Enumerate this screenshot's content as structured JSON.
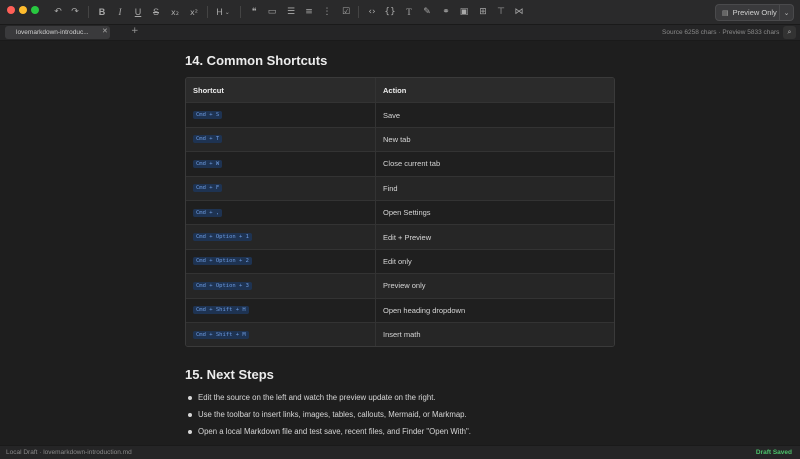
{
  "toolbar": {
    "icons": [
      "undo-icon",
      "redo-icon",
      "bold-icon",
      "italic-icon",
      "underline-icon",
      "strikethrough-icon",
      "subscript-icon",
      "superscript-icon",
      "heading-icon",
      "blockquote-icon",
      "comment-icon",
      "bullet-list-icon",
      "ordered-list-icon",
      "numbered-list-icon",
      "task-list-icon",
      "code-icon",
      "code-block-icon",
      "text-format-icon",
      "highlight-icon",
      "link-icon",
      "image-icon",
      "table-icon",
      "mermaid-icon",
      "markmap-icon"
    ],
    "heading_label": "H",
    "view_mode": "Preview Only"
  },
  "tabs": {
    "active_tab": "lovemarkdown-introduc...",
    "stats": "Source 6258 chars · Preview 5833 chars"
  },
  "doc": {
    "section14_title": "14. Common Shortcuts",
    "table": {
      "headers": [
        "Shortcut",
        "Action"
      ],
      "rows": [
        {
          "shortcut": "Cmd + S",
          "action": "Save"
        },
        {
          "shortcut": "Cmd + T",
          "action": "New tab"
        },
        {
          "shortcut": "Cmd + W",
          "action": "Close current tab"
        },
        {
          "shortcut": "Cmd + F",
          "action": "Find"
        },
        {
          "shortcut": "Cmd + ,",
          "action": "Open Settings"
        },
        {
          "shortcut": "Cmd + Option + 1",
          "action": "Edit + Preview"
        },
        {
          "shortcut": "Cmd + Option + 2",
          "action": "Edit only"
        },
        {
          "shortcut": "Cmd + Option + 3",
          "action": "Preview only"
        },
        {
          "shortcut": "Cmd + Shift + H",
          "action": "Open heading dropdown"
        },
        {
          "shortcut": "Cmd + Shift + M",
          "action": "Insert math"
        }
      ]
    },
    "section15_title": "15. Next Steps",
    "steps": [
      "Edit the source on the left and watch the preview update on the right.",
      "Use the toolbar to insert links, images, tables, callouts, Mermaid, or Markmap.",
      "Open a local Markdown file and test save, recent files, and Finder \"Open With\"."
    ]
  },
  "status": {
    "left": "Local Draft · lovemarkdown-introduction.md",
    "right": "Draft Saved"
  },
  "colors": {
    "accent_green": "#4cc26a",
    "code_text": "#6d9be0",
    "code_bg": "#1e3352"
  }
}
